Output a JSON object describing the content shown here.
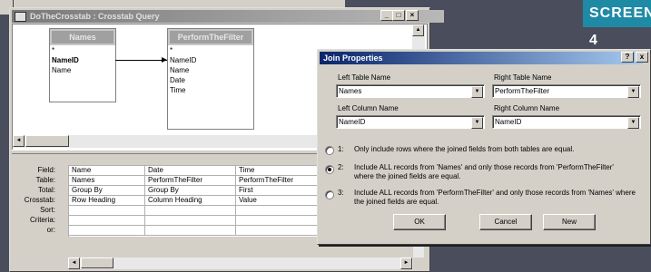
{
  "screen_badge": "SCREEN 4",
  "query_window": {
    "title": "DoTheCrosstab : Crosstab Query",
    "tables": [
      {
        "name": "Names",
        "fields": [
          "*",
          "NameID",
          "Name"
        ]
      },
      {
        "name": "PerformTheFilter",
        "fields": [
          "*",
          "NameID",
          "Name",
          "Date",
          "Time"
        ]
      }
    ],
    "grid": {
      "row_labels": [
        "Field:",
        "Table:",
        "Total:",
        "Crosstab:",
        "Sort:",
        "Criteria:",
        "or:"
      ],
      "columns": [
        [
          "Name",
          "Names",
          "Group By",
          "Row Heading",
          "",
          "",
          ""
        ],
        [
          "Date",
          "PerformTheFilter",
          "Group By",
          "Column Heading",
          "",
          "",
          ""
        ],
        [
          "Time",
          "PerformTheFilter",
          "First",
          "Value",
          "",
          "",
          ""
        ],
        [
          "",
          "",
          "",
          "",
          "",
          "",
          ""
        ]
      ]
    }
  },
  "join_dialog": {
    "title": "Join Properties",
    "help": "?",
    "close": "x",
    "left_table_label": "Left Table Name",
    "right_table_label": "Right Table Name",
    "left_table_value": "Names",
    "right_table_value": "PerformTheFilter",
    "left_column_label": "Left Column Name",
    "right_column_label": "Right Column Name",
    "left_column_value": "NameID",
    "right_column_value": "NameID",
    "options": [
      {
        "num": "1:",
        "text": "Only include rows where the joined fields from both tables are equal.",
        "selected": false
      },
      {
        "num": "2:",
        "text": "Include ALL records from 'Names' and only those records from 'PerformTheFilter' where the joined fields are equal.",
        "selected": true
      },
      {
        "num": "3:",
        "text": "Include ALL records from 'PerformTheFilter' and only those records from 'Names' where the joined fields are equal.",
        "selected": false
      }
    ],
    "ok": "OK",
    "cancel": "Cancel",
    "new": "New"
  }
}
